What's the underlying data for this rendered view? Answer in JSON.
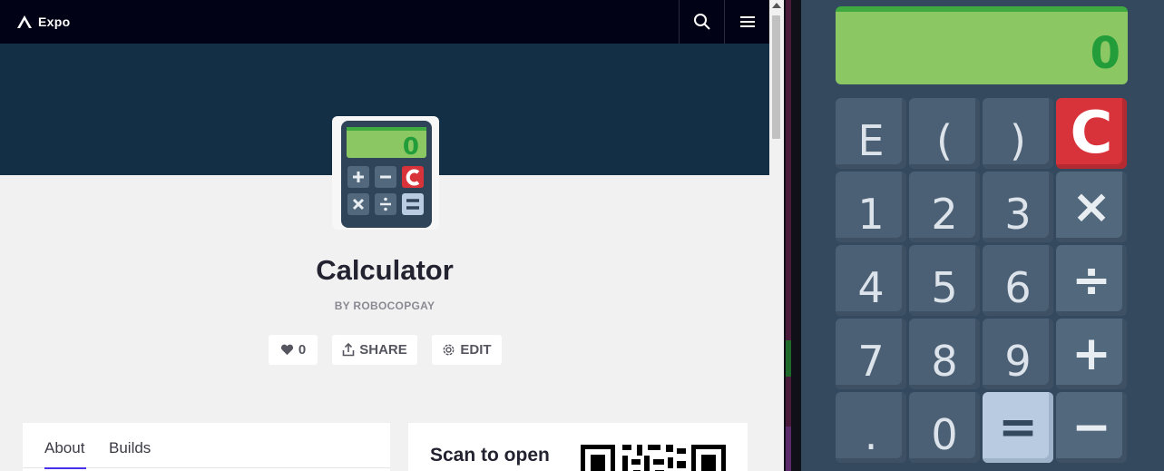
{
  "browser": {
    "brand": "Expo",
    "app": {
      "title": "Calculator",
      "author": "BY ROBOCOPGAY",
      "likes": "0",
      "share_label": "SHARE",
      "edit_label": "EDIT",
      "icon_display": "0"
    },
    "tabs": [
      {
        "label": "About",
        "active": true
      },
      {
        "label": "Builds",
        "active": false
      }
    ],
    "qr_heading": "Scan to open"
  },
  "calculator": {
    "display": "0",
    "keys": [
      {
        "label": "E",
        "kind": "digit"
      },
      {
        "label": "(",
        "kind": "digit"
      },
      {
        "label": ")",
        "kind": "digit"
      },
      {
        "label": "C",
        "kind": "clear"
      },
      {
        "label": "1",
        "kind": "digit"
      },
      {
        "label": "2",
        "kind": "digit"
      },
      {
        "label": "3",
        "kind": "digit"
      },
      {
        "label": "×",
        "kind": "op"
      },
      {
        "label": "4",
        "kind": "digit"
      },
      {
        "label": "5",
        "kind": "digit"
      },
      {
        "label": "6",
        "kind": "digit"
      },
      {
        "label": "÷",
        "kind": "op"
      },
      {
        "label": "7",
        "kind": "digit"
      },
      {
        "label": "8",
        "kind": "digit"
      },
      {
        "label": "9",
        "kind": "digit"
      },
      {
        "label": "+",
        "kind": "op"
      },
      {
        "label": ".",
        "kind": "digit"
      },
      {
        "label": "0",
        "kind": "digit"
      },
      {
        "label": "=",
        "kind": "equals"
      },
      {
        "label": "−",
        "kind": "op"
      }
    ],
    "colors": {
      "clear": "#d8323a",
      "equals": "#b8cbe0",
      "display": "#8bc763",
      "display_text": "#239c3a"
    }
  }
}
